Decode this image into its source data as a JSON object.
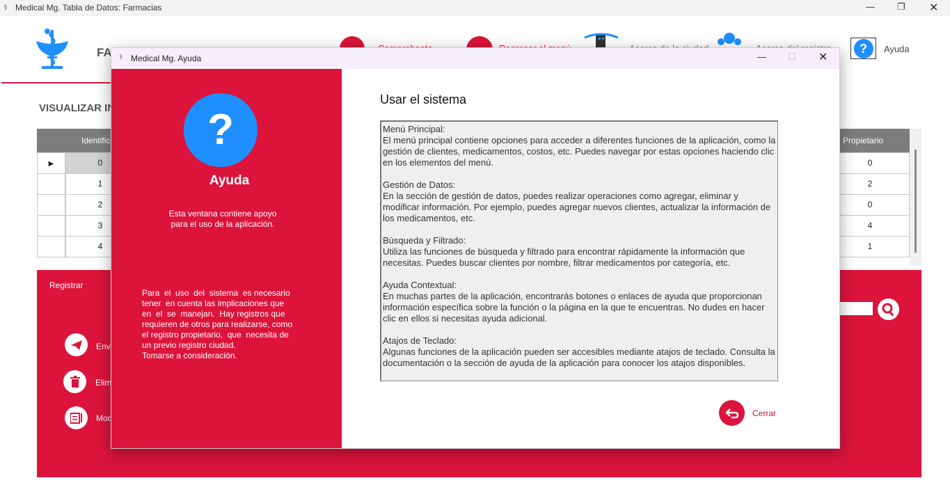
{
  "main_window": {
    "title": "Medical Mg. Tabla de Datos: Farmacias",
    "header": {
      "logo_text": "FARMACIAS",
      "nav_items": [
        {
          "label": "Comprobante",
          "icon": "receipt-icon"
        },
        {
          "label": "Regresar al menú",
          "icon": "back-icon"
        },
        {
          "label": "Acerca de la ciudad",
          "icon": "city-icon"
        },
        {
          "label": "Acerca del registro",
          "icon": "users-icon"
        },
        {
          "label": "Ayuda",
          "icon": "help-icon"
        }
      ]
    },
    "section_title": "VISUALIZAR INFORMACIÓN",
    "table": {
      "columns": [
        "Identificador",
        "Propietario"
      ],
      "rows": [
        {
          "id": "0",
          "propietario": "0"
        },
        {
          "id": "1",
          "propietario": "2"
        },
        {
          "id": "2",
          "propietario": "0"
        },
        {
          "id": "3",
          "propietario": "4"
        },
        {
          "id": "4",
          "propietario": "1"
        }
      ],
      "row_indicator": "▶"
    },
    "lower_panel": {
      "heading": "Registrar",
      "actions": [
        {
          "label": "Enviar",
          "icon": "send-icon"
        },
        {
          "label": "Eliminar",
          "icon": "trash-icon"
        },
        {
          "label": "Modificar",
          "icon": "edit-icon"
        }
      ],
      "search_icon": "search-icon"
    }
  },
  "dialog": {
    "title": "Medical Mg. Ayuda",
    "left_panel": {
      "heading": "Ayuda",
      "description_lines": [
        "Esta ventana contiene apoyo",
        "para el uso de la aplicación."
      ],
      "notes_lines": [
        "Para  el  uso  del  sistema  es necesario",
        "tener  en cuenta las implicaciones que",
        "en  el  se  manejan.  Hay registros que",
        "requieren de otros para realizarse, como",
        "el registro propietario,  que  necesita de",
        "un previo registro ciudad.",
        "Tomarse a consideración."
      ]
    },
    "right_panel": {
      "heading": "Usar el sistema",
      "sections": [
        {
          "title": "Menú Principal:",
          "body": "El menú principal contiene opciones para acceder a diferentes funciones de la aplicación, como la gestión de clientes, medicamentos, costos, etc. Puedes navegar por estas opciones haciendo clic en los elementos del menú."
        },
        {
          "title": "Gestión de Datos:",
          "body": "En la sección de gestión de datos, puedes realizar operaciones como agregar, eliminar y modificar información. Por ejemplo, puedes agregar nuevos clientes, actualizar la información de los medicamentos, etc."
        },
        {
          "title": "Búsqueda y Filtrado:",
          "body": "Utiliza las funciones de búsqueda y filtrado para encontrar rápidamente la información que necesitas. Puedes buscar clientes por nombre, filtrar medicamentos por categoría, etc."
        },
        {
          "title": "Ayuda Contextual:",
          "body": "En muchas partes de la aplicación, encontrarás botones o enlaces de ayuda que proporcionan información específica sobre la función o la página en la que te encuentras. No dudes en hacer clic en ellos si necesitas ayuda adicional."
        },
        {
          "title": "Atajos de Teclado:",
          "body": "Algunas funciones de la aplicación pueden ser accesibles mediante atajos de teclado. Consulta la documentación o la sección de ayuda de la aplicación para conocer los atajos disponibles."
        }
      ],
      "close_label": "Cerrar"
    }
  },
  "colors": {
    "accent": "#dc143c",
    "help_blue": "#1f8fff",
    "dialog_title_bg": "#f6eefb"
  }
}
